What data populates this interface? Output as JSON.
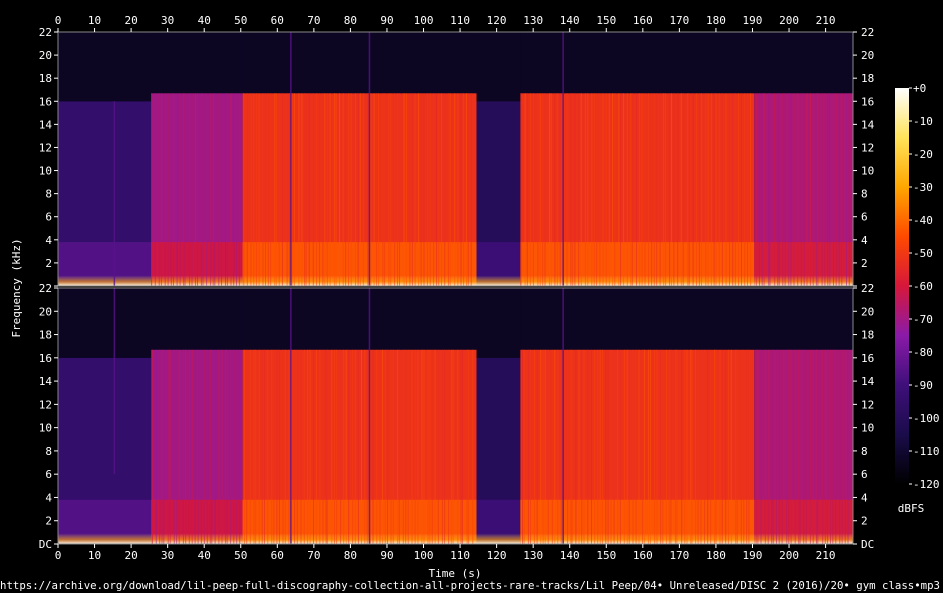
{
  "chart_data": {
    "type": "heatmap",
    "title": "",
    "xlabel": "Time (s)",
    "ylabel": "Frequency (kHz)",
    "xlim": [
      0,
      217.5
    ],
    "ylim": [
      0,
      22
    ],
    "x_ticks": [
      0,
      10,
      20,
      30,
      40,
      50,
      60,
      70,
      80,
      90,
      100,
      110,
      120,
      130,
      140,
      150,
      160,
      170,
      180,
      190,
      200,
      210
    ],
    "y_tick_labels": [
      "DC",
      "2",
      "4",
      "6",
      "8",
      "10",
      "12",
      "14",
      "16",
      "18",
      "20",
      "22"
    ],
    "channels": 2,
    "colorbar": {
      "label": "dBFS",
      "range": [
        -120,
        0
      ],
      "tick_labels": [
        "+0",
        "-10",
        "-20",
        "-30",
        "-40",
        "-50",
        "-60",
        "-70",
        "-80",
        "-90",
        "-100",
        "-110",
        "-120"
      ],
      "colors": [
        "#000000",
        "#1a0c4a",
        "#3f0f7a",
        "#8a1aa8",
        "#d6173a",
        "#ff4a00",
        "#ffa600",
        "#ffe35a",
        "#ffffff"
      ]
    },
    "segments": [
      {
        "start": 0,
        "end": 25.5,
        "cutoff_khz": 16.0,
        "level_db": -95
      },
      {
        "start": 25.5,
        "end": 50.5,
        "cutoff_khz": 16.7,
        "level_db": -70
      },
      {
        "start": 50.5,
        "end": 114.5,
        "cutoff_khz": 16.7,
        "level_db": -52
      },
      {
        "start": 114.5,
        "end": 126.5,
        "cutoff_khz": 16.0,
        "level_db": -100
      },
      {
        "start": 126.5,
        "end": 190.5,
        "cutoff_khz": 16.7,
        "level_db": -52
      },
      {
        "start": 190.5,
        "end": 217.5,
        "cutoff_khz": 16.7,
        "level_db": -68
      }
    ],
    "spike_times": [
      15.2,
      63.5,
      85.0,
      138.0
    ]
  },
  "footer_path": "https://archive.org/download/lil-peep-full-discography-collection-all-projects-rare-tracks/Lil Peep/04• Unreleased/DISC 2 (2016)/20• gym class•mp3"
}
